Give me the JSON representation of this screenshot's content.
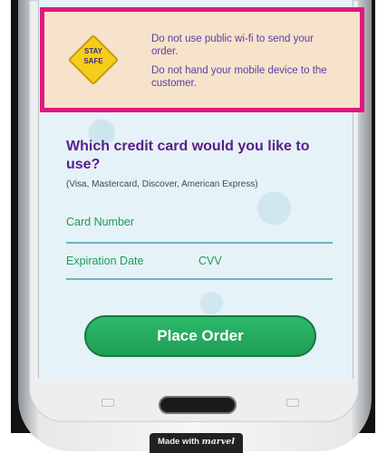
{
  "warning": {
    "sign_text": "STAY\nSAFE",
    "lines": [
      "Do not use public wi-fi to send your order.",
      "Do not hand your mobile device to the customer."
    ]
  },
  "form": {
    "question": "Which credit card would you like to use?",
    "hint": "(Visa, Mastercard, Discover, American Express)",
    "card_number_label": "Card Number",
    "expiration_label": "Expiration Date",
    "cvv_label": "CVV"
  },
  "actions": {
    "place_order_label": "Place Order"
  },
  "badge": {
    "prefix": "Made with ",
    "brand": "marvel"
  },
  "colors": {
    "highlight_border": "#e0187f",
    "accent_green": "#1f9e55",
    "heading_purple": "#5a1e88",
    "warning_background": "#f7e2cb"
  }
}
